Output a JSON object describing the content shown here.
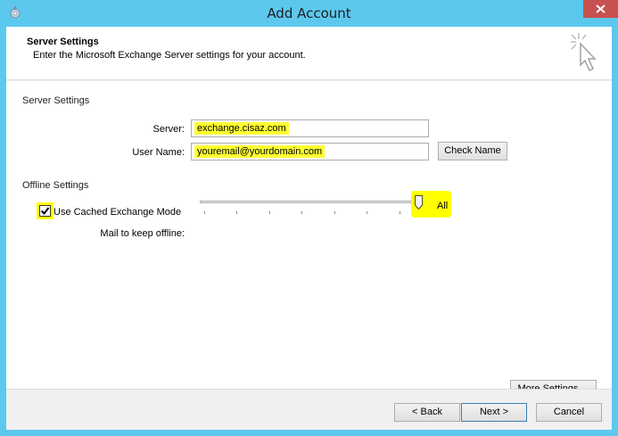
{
  "window": {
    "title": "Add Account",
    "icon": "outlook-app-icon",
    "close_icon": "close-icon"
  },
  "header": {
    "title": "Server Settings",
    "subtitle": "Enter the Microsoft Exchange Server settings for your account.",
    "graphic_icon": "sparkle-cursor-icon"
  },
  "server_section": {
    "label": "Server Settings",
    "server_label": "Server:",
    "server_value": "exchange.cisaz.com",
    "username_label": "User Name:",
    "username_value": "youremail@yourdomain.com",
    "check_name_label": "Check Name"
  },
  "offline_section": {
    "label": "Offline Settings",
    "cached_mode_label": "Use Cached Exchange Mode",
    "cached_mode_checked": true,
    "mail_offline_label": "Mail to keep offline:",
    "slider_value_label": "All",
    "slider_position": 1.0
  },
  "more_settings_label": "More Settings ...",
  "footer": {
    "back_label": "< Back",
    "next_label": "Next >",
    "cancel_label": "Cancel"
  },
  "colors": {
    "frame": "#5cc8ee",
    "highlight": "#ffff00",
    "close": "#c75050"
  }
}
